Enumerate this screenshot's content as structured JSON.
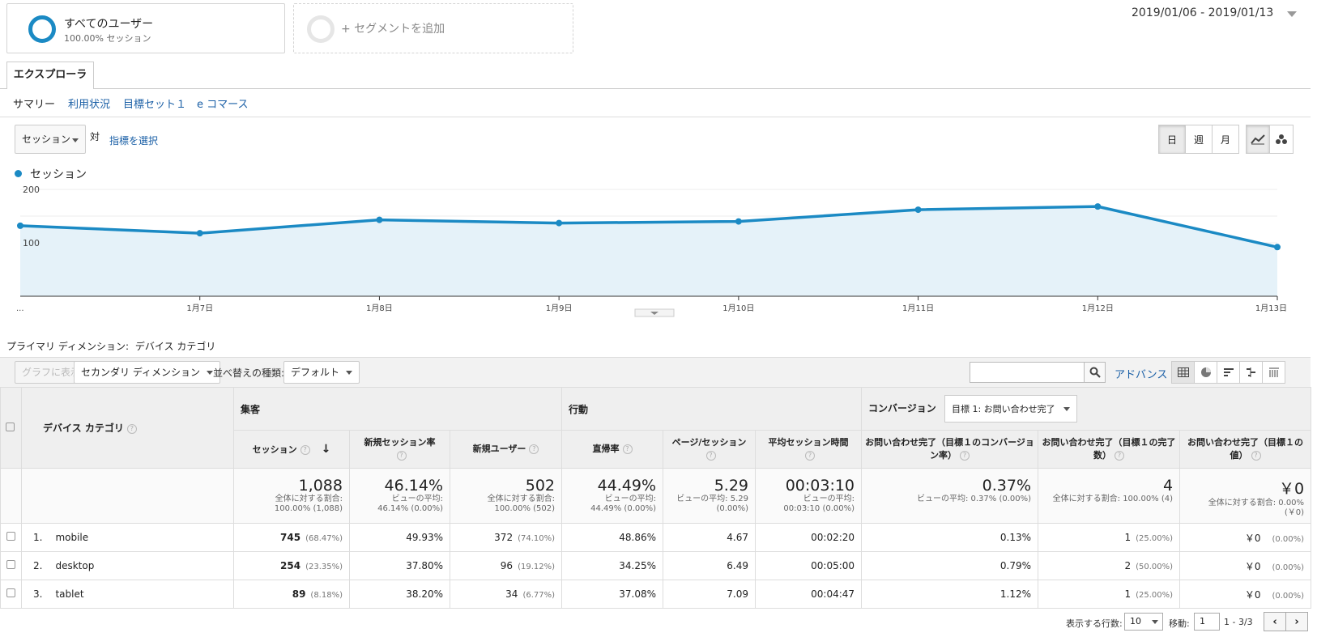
{
  "segments": {
    "active": {
      "title": "すべてのユーザー",
      "subtitle": "100.00% セッション"
    },
    "add_label": "+ セグメントを追加"
  },
  "date_range": "2019/01/06 - 2019/01/13",
  "tabs": {
    "explorer": "エクスプローラ"
  },
  "subtabs": [
    "サマリー",
    "利用状況",
    "目標セット１",
    "e コマース"
  ],
  "metric_selector": {
    "value": "セッション",
    "vs": "対",
    "choose": "指標を選択"
  },
  "period_buttons": [
    "日",
    "週",
    "月"
  ],
  "chart_data": {
    "type": "area",
    "series": [
      {
        "name": "セッション",
        "values": [
          132,
          118,
          143,
          137,
          140,
          162,
          168,
          92
        ]
      }
    ],
    "categories": [
      "...",
      "1月7日",
      "1月8日",
      "1月9日",
      "1月10日",
      "1月11日",
      "1月12日",
      "1月13日"
    ],
    "y_ticks": [
      "100",
      "200"
    ],
    "ylim": [
      0,
      200
    ],
    "color": "#1b8ac4",
    "fill": "#e5f2f9"
  },
  "table_controls": {
    "primary_dimension_label": "プライマリ ディメンション:",
    "primary_dimension_value": "デバイス カテゴリ",
    "plot_rows": "グラフに表示",
    "secondary_dimension": "セカンダリ ディメンション",
    "sort_label": "並べ替えの種類:",
    "sort_value": "デフォルト",
    "advanced": "アドバンス"
  },
  "table": {
    "dim_header": "デバイス カテゴリ",
    "groups": [
      "集客",
      "行動",
      "コンバージョン"
    ],
    "goal_select": "目標 1: お問い合わせ完了",
    "columns": [
      "セッション",
      "新規セッション率",
      "新規ユーザー",
      "直帰率",
      "ページ/セッション",
      "平均セッション時間",
      "お問い合わせ完了（目標１のコンバージョン率）",
      "お問い合わせ完了（目標１の完了数）",
      "お問い合わせ完了（目標１の値）"
    ],
    "totals": [
      {
        "big": "1,088",
        "l1": "全体に対する割合:",
        "l2": "100.00% (1,088)"
      },
      {
        "big": "46.14%",
        "l1": "ビューの平均:",
        "l2": "46.14% (0.00%)"
      },
      {
        "big": "502",
        "l1": "全体に対する割合:",
        "l2": "100.00% (502)"
      },
      {
        "big": "44.49%",
        "l1": "ビューの平均:",
        "l2": "44.49% (0.00%)"
      },
      {
        "big": "5.29",
        "l1": "ビューの平均: 5.29",
        "l2": "(0.00%)"
      },
      {
        "big": "00:03:10",
        "l1": "ビューの平均:",
        "l2": "00:03:10 (0.00%)"
      },
      {
        "big": "0.37%",
        "l1": "ビューの平均: 0.37% (0.00%)",
        "l2": ""
      },
      {
        "big": "4",
        "l1": "全体に対する割合: 100.00% (4)",
        "l2": ""
      },
      {
        "big": "￥0",
        "l1": "全体に対する割合: 0.00%",
        "l2": "(￥0)"
      }
    ],
    "rows": [
      {
        "index": "1.",
        "name": "mobile",
        "sessions": "745",
        "sessions_pct": "(68.47%)",
        "new_rate": "49.93%",
        "new_users": "372",
        "new_users_pct": "(74.10%)",
        "bounce": "48.86%",
        "pages": "4.67",
        "duration": "00:02:20",
        "conv_rate": "0.13%",
        "completions": "1",
        "completions_pct": "(25.00%)",
        "value": "￥0",
        "value_pct": "(0.00%)"
      },
      {
        "index": "2.",
        "name": "desktop",
        "sessions": "254",
        "sessions_pct": "(23.35%)",
        "new_rate": "37.80%",
        "new_users": "96",
        "new_users_pct": "(19.12%)",
        "bounce": "34.25%",
        "pages": "6.49",
        "duration": "00:05:00",
        "conv_rate": "0.79%",
        "completions": "2",
        "completions_pct": "(50.00%)",
        "value": "￥0",
        "value_pct": "(0.00%)"
      },
      {
        "index": "3.",
        "name": "tablet",
        "sessions": "89",
        "sessions_pct": "(8.18%)",
        "new_rate": "38.20%",
        "new_users": "34",
        "new_users_pct": "(6.77%)",
        "bounce": "37.08%",
        "pages": "7.09",
        "duration": "00:04:47",
        "conv_rate": "1.12%",
        "completions": "1",
        "completions_pct": "(25.00%)",
        "value": "￥0",
        "value_pct": "(0.00%)"
      }
    ]
  },
  "footer": {
    "rows_label": "表示する行数:",
    "rows_value": "10",
    "goto_label": "移動:",
    "page_value": "1",
    "range": "1 - 3/3"
  }
}
